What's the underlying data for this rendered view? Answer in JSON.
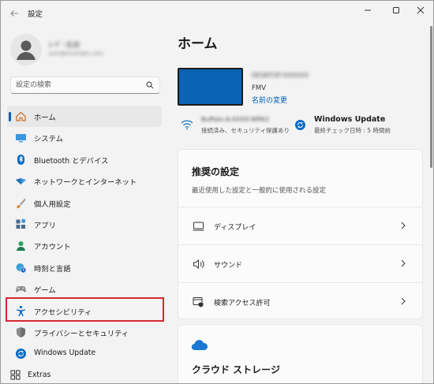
{
  "window": {
    "title": "設定",
    "back_icon": "back-arrow-icon",
    "controls": [
      "minimize",
      "maximize",
      "close"
    ]
  },
  "profile": {
    "name": "ﾕｰｻﾞｰ名前",
    "email": "user@example.com"
  },
  "search": {
    "placeholder": "設定の検索",
    "icon": "search-icon"
  },
  "sidebar": {
    "items": [
      {
        "label": "ホーム",
        "icon": "home-icon",
        "active": true
      },
      {
        "label": "システム",
        "icon": "monitor-icon",
        "active": false
      },
      {
        "label": "Bluetooth とデバイス",
        "icon": "bluetooth-icon",
        "active": false
      },
      {
        "label": "ネットワークとインターネット",
        "icon": "network-icon",
        "active": false
      },
      {
        "label": "個人用設定",
        "icon": "brush-icon",
        "active": false
      },
      {
        "label": "アプリ",
        "icon": "apps-icon",
        "active": false
      },
      {
        "label": "アカウント",
        "icon": "account-icon",
        "active": false
      },
      {
        "label": "時刻と言語",
        "icon": "globe-clock-icon",
        "active": false
      },
      {
        "label": "ゲーム",
        "icon": "gamepad-icon",
        "active": false
      },
      {
        "label": "アクセシビリティ",
        "icon": "accessibility-icon",
        "active": false,
        "highlighted": true
      },
      {
        "label": "プライバシーとセキュリティ",
        "icon": "shield-icon",
        "active": false
      },
      {
        "label": "Windows Update",
        "icon": "update-icon",
        "active": false
      }
    ],
    "extras": {
      "label": "Extras",
      "icon": "extras-icon"
    }
  },
  "main": {
    "title": "ホーム",
    "device": {
      "name": "DESKTOP-XXXXXX",
      "model": "FMV",
      "rename_link": "名前の変更"
    },
    "network": {
      "name": "Buffalo-A-XXXX-WPA3",
      "status": "接続済み、セキュリティ保護あり"
    },
    "update": {
      "title": "Windows Update",
      "subtitle": "最終チェック日時 : 5 時間前"
    },
    "recommended": {
      "title": "推奨の設定",
      "subtitle": "最近使用した設定と一般的に使用される設定",
      "rows": [
        {
          "label": "ディスプレイ",
          "icon": "display-icon"
        },
        {
          "label": "サウンド",
          "icon": "speaker-icon"
        },
        {
          "label": "検索アクセス許可",
          "icon": "search-permission-icon"
        }
      ]
    },
    "cloud": {
      "title": "クラウド ストレージ",
      "icon": "cloud-icon"
    }
  },
  "colors": {
    "accent": "#005fb8",
    "highlight_box": "#d6262f",
    "device_thumb": "#0a63b4",
    "background": "#f3f3f3",
    "card": "#fbfbfb"
  }
}
